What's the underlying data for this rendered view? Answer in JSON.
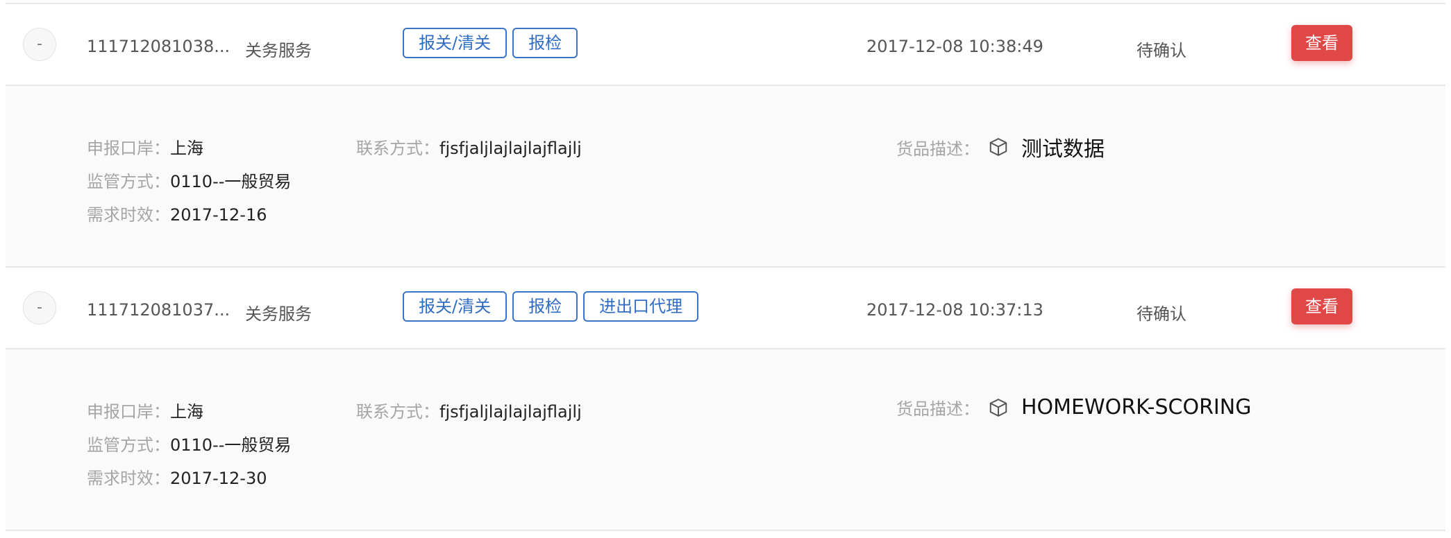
{
  "rows": [
    {
      "order_no": "111712081038...",
      "service": "关务服务",
      "tags": [
        "报关/清关",
        "报检"
      ],
      "time": "2017-12-08 10:38:49",
      "status": "待确认",
      "action": "查看",
      "toggle": "-",
      "details": {
        "port_label": "申报口岸：",
        "port_value": "上海",
        "supervision_label": "监管方式：",
        "supervision_value": "0110--一般贸易",
        "deadline_label": "需求时效：",
        "deadline_value": "2017-12-16",
        "contact_label": "联系方式：",
        "contact_value": "fjsfjaljlajlajlajflajlj",
        "goods_label": "货品描述：",
        "goods_value": "测试数据",
        "goods_icon": "cube-icon"
      }
    },
    {
      "order_no": "111712081037...",
      "service": "关务服务",
      "tags": [
        "报关/清关",
        "报检",
        "进出口代理"
      ],
      "time": "2017-12-08 10:37:13",
      "status": "待确认",
      "action": "查看",
      "toggle": "-",
      "details": {
        "port_label": "申报口岸：",
        "port_value": "上海",
        "supervision_label": "监管方式：",
        "supervision_value": "0110--一般贸易",
        "deadline_label": "需求时效：",
        "deadline_value": "2017-12-30",
        "contact_label": "联系方式：",
        "contact_value": "fjsfjaljlajlajlajflajlj",
        "goods_label": "货品描述：",
        "goods_value": "HOMEWORK-SCORING",
        "goods_icon": "cube-icon"
      }
    }
  ],
  "colors": {
    "tag_border": "#3a74c9",
    "tag_text": "#2f6cc4",
    "view_button": "#e04848",
    "expand_bg": "#fafafa"
  }
}
